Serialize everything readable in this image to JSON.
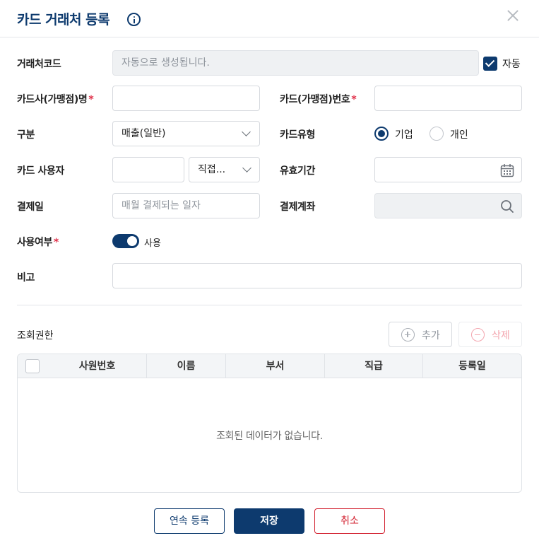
{
  "header": {
    "title": "카드 거래처 등록"
  },
  "form": {
    "code": {
      "label": "거래처코드",
      "placeholder": "자동으로 생성됩니다.",
      "auto_label": "자동",
      "auto_checked": true
    },
    "card_name": {
      "label": "카드사(가맹점)명",
      "required_mark": "*",
      "value": ""
    },
    "card_number": {
      "label": "카드(가맹점)번호",
      "required_mark": "*",
      "value": ""
    },
    "category": {
      "label": "구분",
      "value": "매출(일반)"
    },
    "card_type": {
      "label": "카드유형",
      "options": [
        "기업",
        "개인"
      ],
      "selected": "기업"
    },
    "card_user": {
      "label": "카드 사용자",
      "value": "",
      "select_value": "직접..."
    },
    "validity": {
      "label": "유효기간",
      "value": ""
    },
    "pay_day": {
      "label": "결제일",
      "placeholder": "매월 결제되는 일자"
    },
    "pay_account": {
      "label": "결제계좌",
      "value": ""
    },
    "usage": {
      "label": "사용여부",
      "required_mark": "*",
      "toggle_on": true,
      "toggle_label": "사용"
    },
    "note": {
      "label": "비고",
      "value": ""
    }
  },
  "permissions": {
    "label": "조회권한",
    "add_button": "추가",
    "delete_button": "삭제",
    "columns": [
      "사원번호",
      "이름",
      "부서",
      "직급",
      "등록일"
    ],
    "rows": [],
    "empty_message": "조회된 데이터가 없습니다."
  },
  "footer": {
    "continue_button": "연속 등록",
    "save_button": "저장",
    "cancel_button": "취소"
  },
  "colors": {
    "primary": "#0d3a6e",
    "required": "#e0314a",
    "danger": "#d2202f"
  }
}
